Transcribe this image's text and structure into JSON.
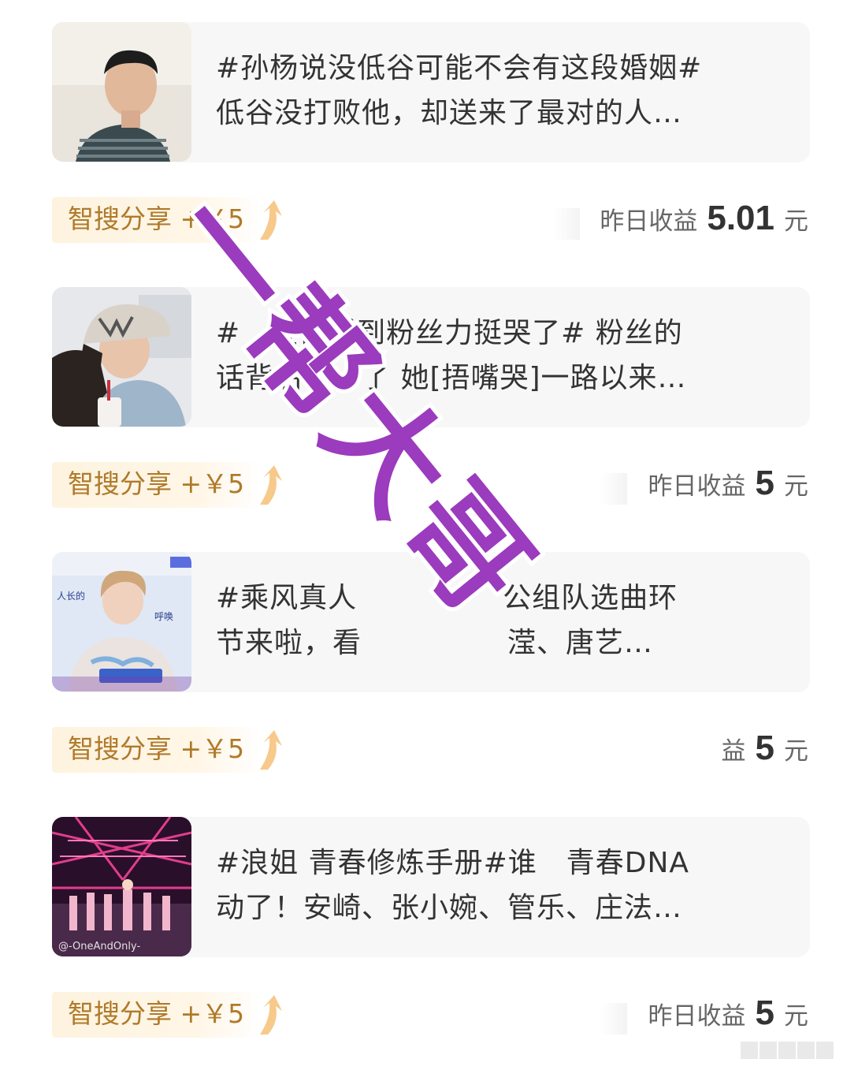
{
  "feed": {
    "items": [
      {
        "title_line1": "#孙杨说没低谷可能不会有这段婚姻#",
        "title_line2": "低谷没打败他，却送来了最对的人…",
        "reward_label": "智搜分享",
        "reward_amount": "+￥5",
        "earn_label": "昨日收益",
        "earn_value": "5.01",
        "earn_unit": "元"
      },
      {
        "title_line1": "#　宣仪听到粉丝力挺哭了# 粉丝的",
        "title_line2": "话背后　　了 她[捂嘴哭]一路以来…",
        "reward_label": "智搜分享",
        "reward_amount": "+￥5",
        "earn_label": "昨日收益",
        "earn_value": "5",
        "earn_unit": "元"
      },
      {
        "title_line1": "#乘风真人　　　　　公组队选曲环",
        "title_line2": "节来啦，看　　　　　滢、唐艺…",
        "thumb_caption_left": "人长的",
        "thumb_caption_right": "呼唤",
        "reward_label": "智搜分享",
        "reward_amount": "+￥5",
        "earn_label": "益",
        "earn_value": "5",
        "earn_unit": "元"
      },
      {
        "title_line1": "#浪姐 青春修炼手册#谁　青春DNA",
        "title_line2": "动了！安崎、张小婉、管乐、庄法…",
        "thumb_watermark": "@-OneAndOnly-",
        "reward_label": "智搜分享",
        "reward_amount": "+￥5",
        "earn_label": "昨日收益",
        "earn_value": "5",
        "earn_unit": "元"
      }
    ]
  },
  "overlay": {
    "watermark_text": "一帮大哥",
    "color": "#9b3bbd"
  },
  "colors": {
    "card_bg": "#f7f7f7",
    "reward_text": "#b07a2a",
    "reward_bg": "#fdf3df",
    "title_text": "#333333"
  }
}
